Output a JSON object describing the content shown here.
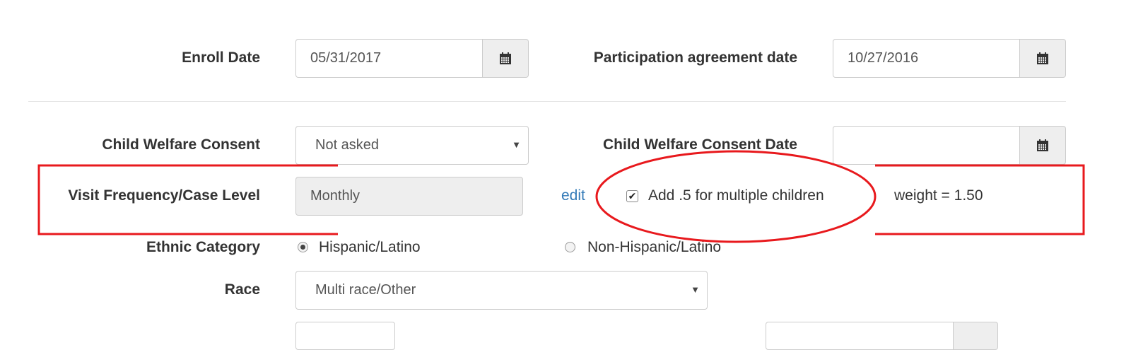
{
  "enroll_date": {
    "label": "Enroll Date",
    "value": "05/31/2017",
    "icon": "calendar-icon"
  },
  "participation_date": {
    "label": "Participation agreement date",
    "value": "10/27/2016",
    "icon": "calendar-icon"
  },
  "cw_consent": {
    "label": "Child Welfare Consent",
    "selected": "Not asked"
  },
  "cw_consent_date": {
    "label": "Child Welfare Consent Date",
    "value": "",
    "icon": "calendar-icon"
  },
  "visit_frequency": {
    "label": "Visit Frequency/Case Level",
    "value": "Monthly",
    "edit_label": "edit"
  },
  "multiple_children": {
    "label": "Add .5 for multiple children",
    "checked": true
  },
  "weight": {
    "text": "weight = 1.50"
  },
  "ethnic": {
    "label": "Ethnic Category",
    "options": [
      {
        "label": "Hispanic/Latino",
        "selected": true
      },
      {
        "label": "Non-Hispanic/Latino",
        "selected": false
      }
    ]
  },
  "race": {
    "label": "Race",
    "selected": "Multi race/Other"
  },
  "annotation_color": "#e8191d"
}
